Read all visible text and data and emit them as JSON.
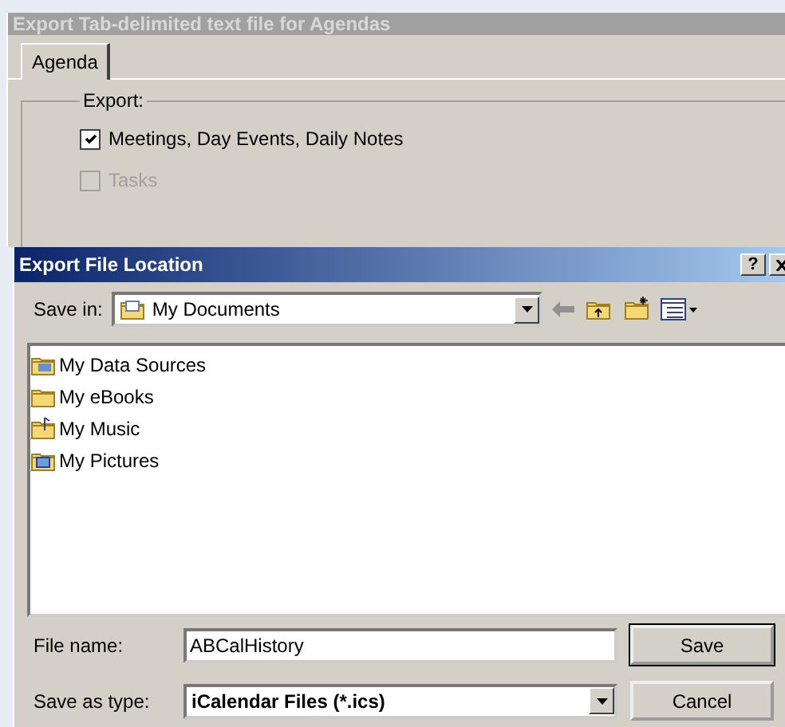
{
  "export_window": {
    "title": "Export Tab-delimited text file for Agendas",
    "tabs": [
      {
        "label": "Agenda",
        "selected": true
      }
    ],
    "group": {
      "label": "Export:",
      "options": [
        {
          "label": "Meetings, Day Events, Daily Notes",
          "checked": true,
          "disabled": false
        },
        {
          "label": "Tasks",
          "checked": false,
          "disabled": true
        }
      ]
    }
  },
  "file_dialog": {
    "title": "Export File Location",
    "help_button": "?",
    "save_in": {
      "label": "Save in:",
      "value": "My Documents"
    },
    "items": [
      {
        "name": "My Data Sources",
        "kind": "data"
      },
      {
        "name": "My eBooks",
        "kind": "folder"
      },
      {
        "name": "My Music",
        "kind": "music"
      },
      {
        "name": "My Pictures",
        "kind": "pictures"
      }
    ],
    "file_name": {
      "label": "File name:",
      "value": "ABCalHistory"
    },
    "save_as_type": {
      "label": "Save as type:",
      "value": "iCalendar Files (*.ics)"
    },
    "buttons": [
      "Save",
      "Cancel"
    ]
  }
}
